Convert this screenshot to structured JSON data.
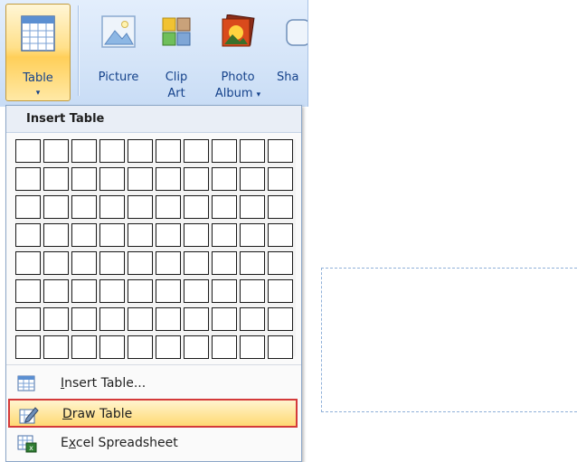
{
  "ribbon": {
    "table_button": {
      "label": "Table",
      "icon": "table-grid-icon"
    },
    "picture_button": {
      "label": "Picture",
      "icon": "picture-icon"
    },
    "clip_art_button": {
      "label_line1": "Clip",
      "label_line2": "Art",
      "icon": "clip-art-icon"
    },
    "photo_album_button": {
      "label_line1": "Photo",
      "label_line2": "Album",
      "dropdown_arrow": "▾",
      "icon": "photo-album-icon"
    },
    "shapes_button": {
      "label_partial": "Sha",
      "icon": "shapes-icon"
    }
  },
  "insert_table_menu": {
    "header": "Insert Table",
    "grid": {
      "columns": 10,
      "rows": 8
    },
    "items": [
      {
        "label_mnemonic": "I",
        "label_rest": "nsert Table...",
        "icon": "insert-table-icon",
        "highlighted": false
      },
      {
        "label_mnemonic": "D",
        "label_rest": "raw Table",
        "icon": "draw-table-pencil-icon",
        "highlighted": true
      },
      {
        "label_prefix": "E",
        "label_mnemonic": "x",
        "label_rest": "cel Spreadsheet",
        "icon": "excel-spreadsheet-icon",
        "highlighted": false
      }
    ]
  },
  "colors": {
    "ribbon_bg": "#d4e4f8",
    "highlight_fill": "#ffe08a",
    "highlight_border": "#d43a3a",
    "placeholder_dash": "#8fb0d9"
  }
}
